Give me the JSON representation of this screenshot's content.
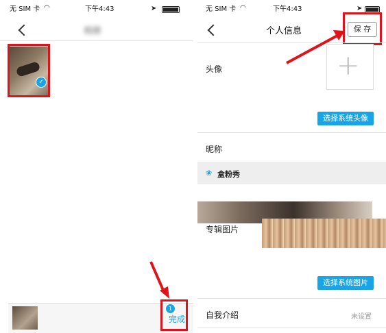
{
  "left": {
    "status": {
      "carrier": "无 SIM 卡",
      "time": "下午4:43"
    },
    "nav": {
      "title": "相册"
    },
    "bottom": {
      "count": "1",
      "done_label": "完成"
    }
  },
  "right": {
    "status": {
      "carrier": "无 SIM 卡",
      "time": "下午4:43"
    },
    "nav": {
      "title": "个人信息",
      "save_label": "保 存"
    },
    "avatar": {
      "label": "头像",
      "button": "选择系统头像"
    },
    "nickname": {
      "label": "昵称",
      "value": "盒粉秀"
    },
    "album": {
      "label": "专辑图片",
      "button": "选择系统图片"
    },
    "intro": {
      "label": "自我介绍",
      "value": "未设置"
    }
  },
  "colors": {
    "accent": "#1aa4e8",
    "annotation": "#e0121a",
    "nickname_bg": "#eeeeee"
  }
}
